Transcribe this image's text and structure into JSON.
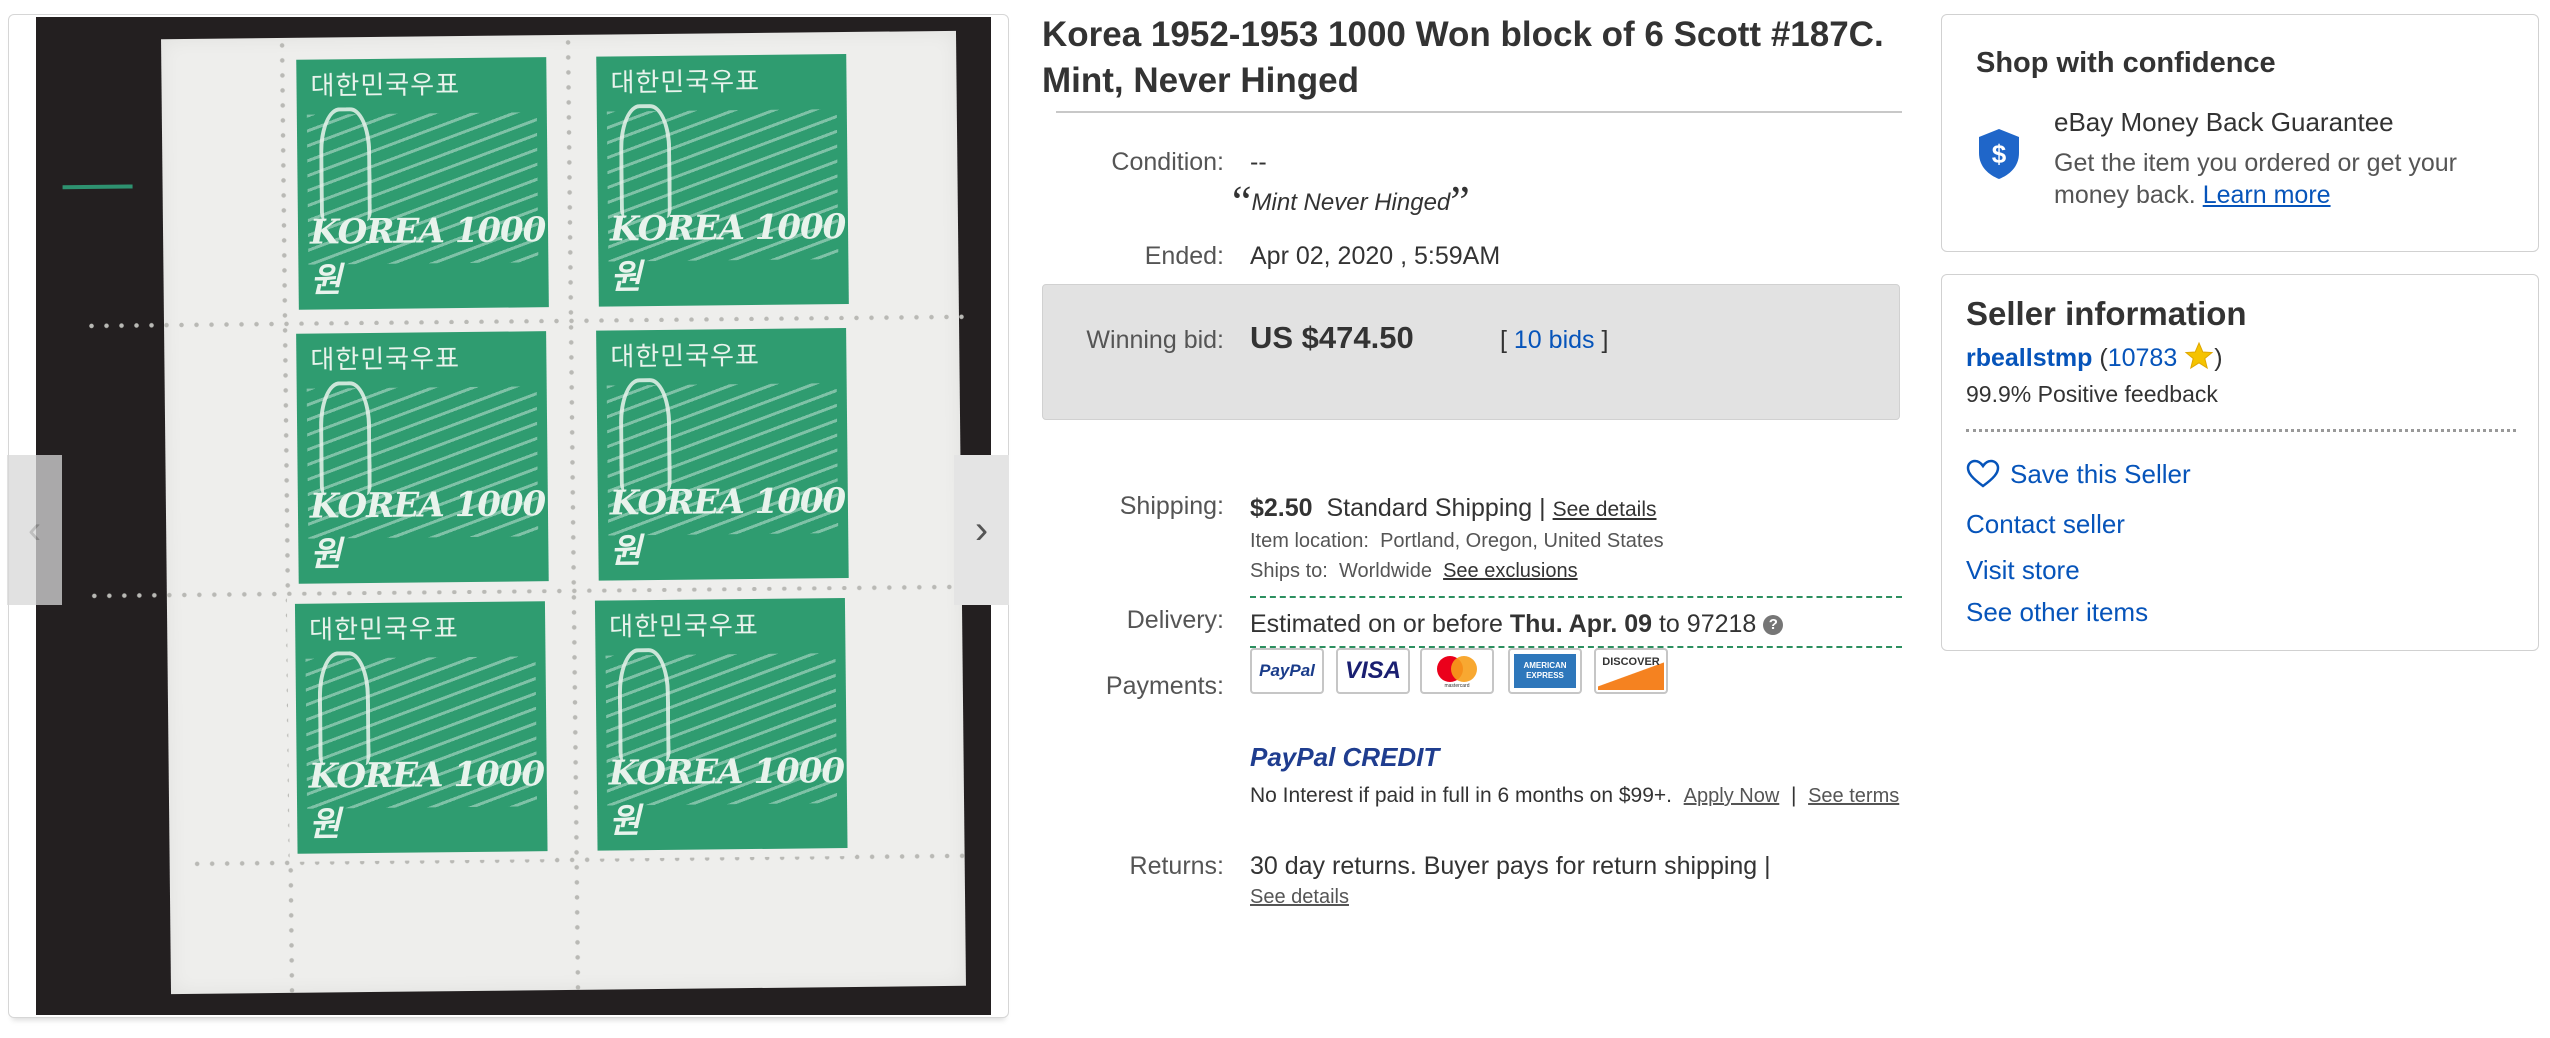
{
  "listing": {
    "title": "Korea 1952-1953 1000 Won block of 6 Scott #187C. Mint, Never Hinged",
    "image_alt": "Block of 6 Korea 1000 Won stamps",
    "stamp_text_korean": "대한민국우표",
    "stamp_text_country": "KOREA",
    "stamp_text_value": "1000원"
  },
  "gallery": {
    "prev_icon": "‹",
    "next_icon": "›"
  },
  "condition": {
    "label": "Condition:",
    "value": "--",
    "quote_open": "“",
    "note": "Mint Never Hinged",
    "quote_close": "”"
  },
  "ended": {
    "label": "Ended:",
    "value": "Apr 02, 2020 , 5:59AM"
  },
  "bid": {
    "label": "Winning bid:",
    "amount": "US $474.50",
    "bracket_open": "[",
    "bids_link": "10 bids",
    "bracket_close": "]"
  },
  "shipping": {
    "label": "Shipping:",
    "cost": "$2.50",
    "method": "Standard Shipping",
    "separator": "|",
    "details_link": "See details",
    "location_label": "Item location:",
    "location": "Portland, Oregon, United States",
    "ships_to_label": "Ships to:",
    "ships_to": "Worldwide",
    "exclusions_link": "See exclusions"
  },
  "delivery": {
    "label": "Delivery:",
    "prefix": "Estimated on or before",
    "date": "Thu. Apr. 09",
    "to": "to",
    "zip": "97218",
    "help_icon": "?"
  },
  "payments": {
    "label": "Payments:",
    "cards": [
      "PayPal",
      "VISA",
      "mastercard",
      "AMERICAN EXPRESS",
      "DISCOVER"
    ]
  },
  "paypal_credit": {
    "logo_paypal": "PayPal",
    "logo_credit": "CREDIT",
    "text": "No Interest if paid in full in 6 months on $99+.",
    "apply_link": "Apply Now",
    "separator": "|",
    "terms_link": "See terms"
  },
  "returns": {
    "label": "Returns:",
    "text": "30 day returns. Buyer pays for return shipping |",
    "details_link": "See details"
  },
  "confidence": {
    "heading": "Shop with confidence",
    "guarantee_title": "eBay Money Back Guarantee",
    "guarantee_text_1": "Get the item you ordered or get your",
    "guarantee_text_2": "money back.",
    "learn_more": "Learn more",
    "shield_glyph": "$"
  },
  "seller": {
    "heading": "Seller information",
    "name": "rbeallstmp",
    "paren_open": "(",
    "score": "10783",
    "paren_close": ")",
    "feedback": "99.9% Positive feedback",
    "save_link": "Save this Seller",
    "contact_link": "Contact seller",
    "store_link": "Visit store",
    "other_link": "See other items"
  },
  "colors": {
    "link": "#0654ba",
    "stamp_green": "#2f9c70",
    "bid_box": "#e2e2e2",
    "dashed_rule": "#2c8f5f"
  }
}
